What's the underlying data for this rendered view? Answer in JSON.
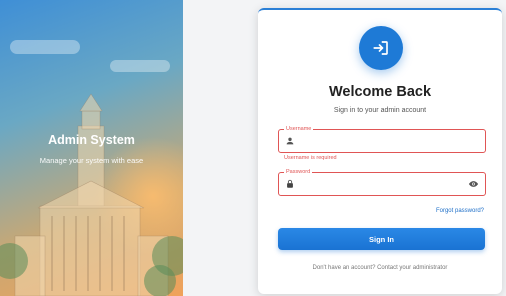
{
  "hero": {
    "title": "Admin System",
    "subtitle": "Manage your system with ease"
  },
  "card": {
    "logo_icon": "login-arrow-icon",
    "title": "Welcome Back",
    "subtitle": "Sign in to your admin account",
    "username": {
      "label": "Username",
      "value": "",
      "icon": "user-icon",
      "error": "Username is required"
    },
    "password": {
      "label": "Password",
      "value": "",
      "icon": "lock-icon",
      "toggle_icon": "eye-icon"
    },
    "forgot_label": "Forgot password?",
    "signin_label": "Sign In",
    "footer_text": "Don't have an account? Contact your administrator"
  },
  "colors": {
    "accent": "#1e7ad6",
    "error": "#e05555"
  }
}
